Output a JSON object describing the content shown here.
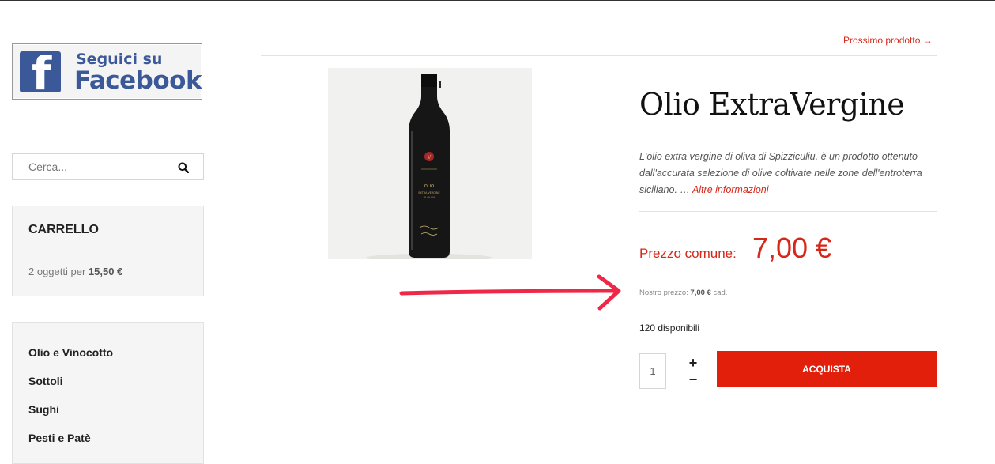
{
  "facebook_banner": {
    "line1": "Seguici su",
    "line2": "Facebook",
    "logo_letter": "f",
    "brand_color": "#3b5998"
  },
  "search": {
    "placeholder": "Cerca...",
    "icon": "search-icon"
  },
  "cart": {
    "title": "CARRELLO",
    "summary_prefix": "2 oggetti per",
    "summary_total": "15,50 €"
  },
  "categories": [
    {
      "label": "Olio e Vinocotto"
    },
    {
      "label": "Sottoli"
    },
    {
      "label": "Sughi"
    },
    {
      "label": "Pesti e Patè"
    }
  ],
  "nav": {
    "next_product": "Prossimo prodotto →"
  },
  "product": {
    "title": "Olio ExtraVergine",
    "description": "L'olio extra vergine di oliva di Spizziculiu, è un prodotto ottenuto dall'accurata selezione di olive coltivate nelle zone dell'entroterra siciliano. …",
    "more_link": "Altre informazioni",
    "price_label": "Prezzo comune:",
    "price_value": "7,00 €",
    "our_price_label": "Nostro prezzo:",
    "our_price_value": "7,00 €",
    "our_price_unit": "cad.",
    "stock": "120 disponibili",
    "quantity": "1",
    "buy_label": "ACQUISTA",
    "bottle_label_lines": [
      "OLIO",
      "EXTRA VERGINE",
      "DI OLIVA"
    ]
  },
  "colors": {
    "accent": "#d6281a",
    "button": "#e11f0b",
    "annotation_arrow": "#f02848"
  }
}
